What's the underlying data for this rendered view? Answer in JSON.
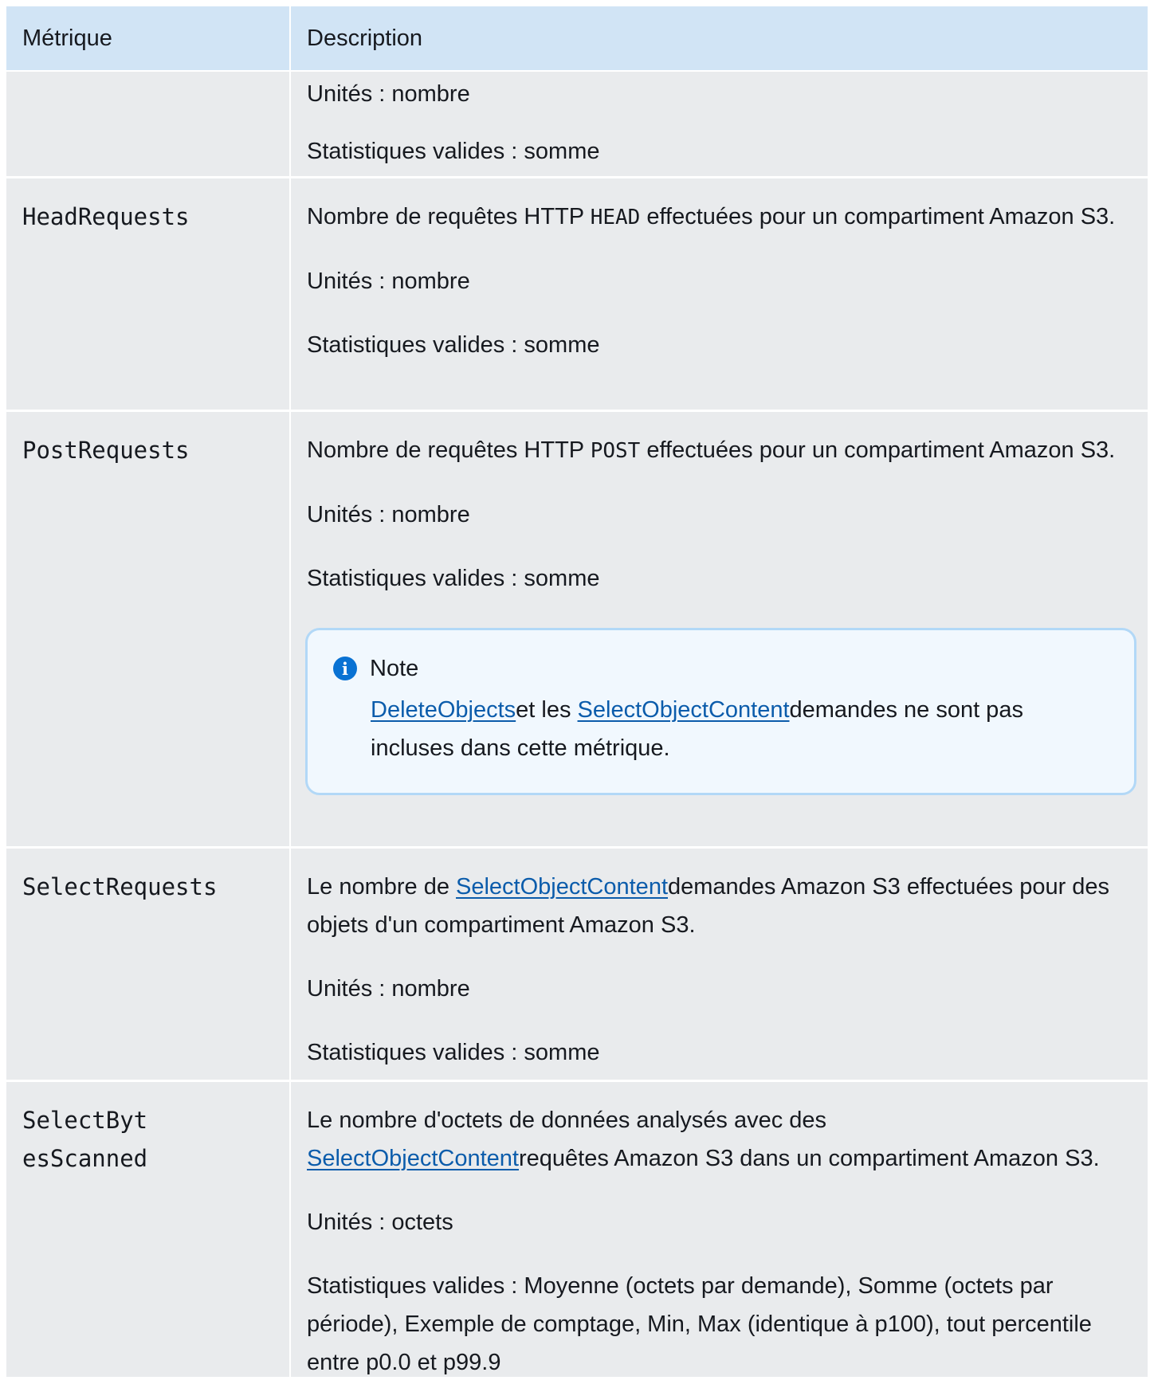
{
  "header": {
    "metric": "Métrique",
    "description": "Description"
  },
  "rows": [
    {
      "units": "Unités : nombre",
      "stats": "Statistiques valides : somme"
    },
    {
      "metric": "HeadRequests",
      "desc_pre": "Nombre de requêtes HTTP ",
      "desc_code": "HEAD",
      "desc_post": " effectuées pour un compartiment Amazon S3.",
      "units": "Unités : nombre",
      "stats": "Statistiques valides : somme"
    },
    {
      "metric": "PostRequests",
      "desc_pre": "Nombre de requêtes HTTP ",
      "desc_code": "POST",
      "desc_post": " effectuées pour un compartiment Amazon S3.",
      "units": "Unités : nombre",
      "stats": "Statistiques valides : somme",
      "note": {
        "title": "Note",
        "link1": "DeleteObjects",
        "mid": "et les ",
        "link2": "SelectObjectContent",
        "post": "demandes ne sont pas incluses dans cette métrique."
      }
    },
    {
      "metric": "SelectRequests",
      "desc_pre": "Le nombre de ",
      "desc_link": "SelectObjectContent",
      "desc_post": "demandes Amazon S3 effectuées pour des objets d'un compartiment Amazon S3.",
      "units": "Unités : nombre",
      "stats": "Statistiques valides : somme"
    },
    {
      "metric_line1": "SelectByt",
      "metric_line2": "esScanned",
      "desc_pre": "Le nombre d'octets de données analysés avec des ",
      "desc_link": "SelectObjectContent",
      "desc_post": "requêtes Amazon S3 dans un compartiment Amazon S3.",
      "units": "Unités : octets",
      "stats": "Statistiques valides : Moyenne (octets par demande), Somme (octets par période), Exemple de comptage, Min, Max (identique à p100), tout percentile entre p0.0 et p99.9"
    }
  ],
  "colors": {
    "header_bg": "#d1e4f5",
    "row_bg": "#e9ebed",
    "link": "#0b5cab",
    "note_bg": "#f1f8fe",
    "note_border": "#b2d8f7",
    "info_icon": "#0972d3"
  },
  "icons": {
    "note": "info-icon"
  }
}
